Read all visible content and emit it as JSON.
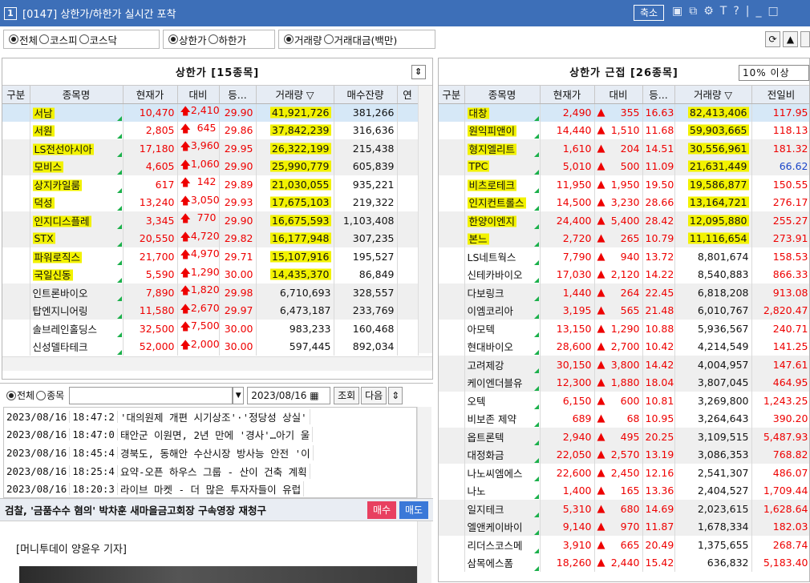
{
  "window": {
    "number": "1",
    "title": "[0147] 상한가/하한가 실시간 포착",
    "shrink_label": "축소"
  },
  "filters": {
    "market": [
      "전체",
      "코스피",
      "코스닥"
    ],
    "limit": [
      "상한가",
      "하한가"
    ],
    "volume": [
      "거래량",
      "거래대금(백만)"
    ]
  },
  "left_panel": {
    "title": "상한가 [15종목]",
    "columns": [
      "구분",
      "종목명",
      "현재가",
      "대비",
      "등...",
      "거래량 ▽",
      "매수잔량",
      "연"
    ],
    "rows": [
      {
        "name": "서남",
        "price": "10,470",
        "diff": "2,410",
        "rate": "29.90",
        "volume": "41,921,726",
        "bid": "381,266",
        "hl": true
      },
      {
        "name": "서원",
        "price": "2,805",
        "diff": "645",
        "rate": "29.86",
        "volume": "37,842,239",
        "bid": "316,636",
        "hl": true
      },
      {
        "name": "LS전선아시아",
        "price": "17,180",
        "diff": "3,960",
        "rate": "29.95",
        "volume": "26,322,199",
        "bid": "215,438",
        "hl": true
      },
      {
        "name": "모비스",
        "price": "4,605",
        "diff": "1,060",
        "rate": "29.90",
        "volume": "25,990,779",
        "bid": "605,839",
        "hl": true
      },
      {
        "name": "상지카일룸",
        "price": "617",
        "diff": "142",
        "rate": "29.89",
        "volume": "21,030,055",
        "bid": "935,221",
        "hl": true
      },
      {
        "name": "덕성",
        "price": "13,240",
        "diff": "3,050",
        "rate": "29.93",
        "volume": "17,675,103",
        "bid": "219,322",
        "hl": true
      },
      {
        "name": "인지디스플레",
        "price": "3,345",
        "diff": "770",
        "rate": "29.90",
        "volume": "16,675,593",
        "bid": "1,103,408",
        "hl": true
      },
      {
        "name": "STX",
        "price": "20,550",
        "diff": "4,720",
        "rate": "29.82",
        "volume": "16,177,948",
        "bid": "307,235",
        "hl": true
      },
      {
        "name": "파워로직스",
        "price": "21,700",
        "diff": "4,970",
        "rate": "29.71",
        "volume": "15,107,916",
        "bid": "195,527",
        "hl": true
      },
      {
        "name": "국일신동",
        "price": "5,590",
        "diff": "1,290",
        "rate": "30.00",
        "volume": "14,435,370",
        "bid": "86,849",
        "hl": true
      },
      {
        "name": "인트론바이오",
        "price": "7,890",
        "diff": "1,820",
        "rate": "29.98",
        "volume": "6,710,693",
        "bid": "328,557",
        "hl": false
      },
      {
        "name": "탑엔지니어링",
        "price": "11,580",
        "diff": "2,670",
        "rate": "29.97",
        "volume": "6,473,187",
        "bid": "233,769",
        "hl": false
      },
      {
        "name": "솔브레인홀딩스",
        "price": "32,500",
        "diff": "7,500",
        "rate": "30.00",
        "volume": "983,233",
        "bid": "160,468",
        "hl": false
      },
      {
        "name": "신성델타테크",
        "price": "52,000",
        "diff": "2,000",
        "rate": "30.00",
        "volume": "597,445",
        "bid": "892,034",
        "hl": false
      }
    ]
  },
  "right_panel": {
    "title": "상한가 근접 [26종목]",
    "threshold": "10% 이상",
    "columns": [
      "구분",
      "종목명",
      "현재가",
      "대비",
      "등...",
      "거래량 ▽",
      "전일비"
    ],
    "rows": [
      {
        "name": "대창",
        "price": "2,490",
        "diff": "355",
        "rate": "16.63",
        "volume": "82,413,406",
        "prev": "117.95",
        "hl": true
      },
      {
        "name": "원익피앤이",
        "price": "14,440",
        "diff": "1,510",
        "rate": "11.68",
        "volume": "59,903,665",
        "prev": "118.13",
        "hl": true
      },
      {
        "name": "형지엘리트",
        "price": "1,610",
        "diff": "204",
        "rate": "14.51",
        "volume": "30,556,961",
        "prev": "181.32",
        "hl": true
      },
      {
        "name": "TPC",
        "price": "5,010",
        "diff": "500",
        "rate": "11.09",
        "volume": "21,631,449",
        "prev": "66.62",
        "hl": true,
        "prevBlue": true
      },
      {
        "name": "비츠로테크",
        "price": "11,950",
        "diff": "1,950",
        "rate": "19.50",
        "volume": "19,586,877",
        "prev": "150.55",
        "hl": true
      },
      {
        "name": "인지컨트롤스",
        "price": "14,500",
        "diff": "3,230",
        "rate": "28.66",
        "volume": "13,164,721",
        "prev": "276.17",
        "hl": true
      },
      {
        "name": "한양이엔지",
        "price": "24,400",
        "diff": "5,400",
        "rate": "28.42",
        "volume": "12,095,880",
        "prev": "255.27",
        "hl": true
      },
      {
        "name": "본느",
        "price": "2,720",
        "diff": "265",
        "rate": "10.79",
        "volume": "11,116,654",
        "prev": "273.91",
        "hl": true
      },
      {
        "name": "LS네트웍스",
        "price": "7,790",
        "diff": "940",
        "rate": "13.72",
        "volume": "8,801,674",
        "prev": "158.53",
        "hl": false
      },
      {
        "name": "신테카바이오",
        "price": "17,030",
        "diff": "2,120",
        "rate": "14.22",
        "volume": "8,540,883",
        "prev": "866.33",
        "hl": false
      },
      {
        "name": "다보링크",
        "price": "1,440",
        "diff": "264",
        "rate": "22.45",
        "volume": "6,818,208",
        "prev": "913.08",
        "hl": false
      },
      {
        "name": "이엠코리아",
        "price": "3,195",
        "diff": "565",
        "rate": "21.48",
        "volume": "6,010,767",
        "prev": "2,820.47",
        "hl": false
      },
      {
        "name": "아모텍",
        "price": "13,150",
        "diff": "1,290",
        "rate": "10.88",
        "volume": "5,936,567",
        "prev": "240.71",
        "hl": false
      },
      {
        "name": "현대바이오",
        "price": "28,600",
        "diff": "2,700",
        "rate": "10.42",
        "volume": "4,214,549",
        "prev": "141.25",
        "hl": false
      },
      {
        "name": "고려제강",
        "price": "30,150",
        "diff": "3,800",
        "rate": "14.42",
        "volume": "4,004,957",
        "prev": "147.61",
        "hl": false
      },
      {
        "name": "케이엔더블유",
        "price": "12,300",
        "diff": "1,880",
        "rate": "18.04",
        "volume": "3,807,045",
        "prev": "464.95",
        "hl": false
      },
      {
        "name": "오텍",
        "price": "6,150",
        "diff": "600",
        "rate": "10.81",
        "volume": "3,269,800",
        "prev": "1,243.25",
        "hl": false
      },
      {
        "name": "비보존 제약",
        "price": "689",
        "diff": "68",
        "rate": "10.95",
        "volume": "3,264,643",
        "prev": "390.20",
        "hl": false
      },
      {
        "name": "옵트론텍",
        "price": "2,940",
        "diff": "495",
        "rate": "20.25",
        "volume": "3,109,515",
        "prev": "5,487.93",
        "hl": false
      },
      {
        "name": "대정화금",
        "price": "22,050",
        "diff": "2,570",
        "rate": "13.19",
        "volume": "3,086,353",
        "prev": "768.82",
        "hl": false
      },
      {
        "name": "나노씨엠에스",
        "price": "22,600",
        "diff": "2,450",
        "rate": "12.16",
        "volume": "2,541,307",
        "prev": "486.07",
        "hl": false
      },
      {
        "name": "나노",
        "price": "1,400",
        "diff": "165",
        "rate": "13.36",
        "volume": "2,404,527",
        "prev": "1,709.44",
        "hl": false
      },
      {
        "name": "일지테크",
        "price": "5,310",
        "diff": "680",
        "rate": "14.69",
        "volume": "2,023,615",
        "prev": "1,628.64",
        "hl": false
      },
      {
        "name": "엘앤케이바이",
        "price": "9,140",
        "diff": "970",
        "rate": "11.87",
        "volume": "1,678,334",
        "prev": "182.03",
        "hl": false
      },
      {
        "name": "리더스코스메",
        "price": "3,910",
        "diff": "665",
        "rate": "20.49",
        "volume": "1,375,655",
        "prev": "268.74",
        "hl": false
      },
      {
        "name": "삼목에스폼",
        "price": "18,260",
        "diff": "2,440",
        "rate": "15.42",
        "volume": "636,832",
        "prev": "5,183.40",
        "hl": false
      }
    ]
  },
  "news": {
    "radio": [
      "전체",
      "종목"
    ],
    "date": "2023/08/16",
    "query_label": "조회",
    "next_label": "다음",
    "items": [
      {
        "date": "2023/08/16",
        "time": "18:47:2",
        "title": "'대의원제 개편 시기상조'·'정당성 상실'"
      },
      {
        "date": "2023/08/16",
        "time": "18:47:0",
        "title": "태안군 이원면, 2년 만에 '경사'…아기 울"
      },
      {
        "date": "2023/08/16",
        "time": "18:45:4",
        "title": "경북도, 동해안 수산시장 방사능 안전 '이"
      },
      {
        "date": "2023/08/16",
        "time": "18:25:4",
        "title": "요약-오픈 하우스 그룹 - 산이 건축 계획"
      },
      {
        "date": "2023/08/16",
        "time": "18:20:3",
        "title": "라이브 마켓 - 더 많은 투자자들이 유럽"
      }
    ],
    "headline": "검찰, '금품수수 혐의' 박차훈 새마을금고회장 구속영장 재청구",
    "buy_label": "매수",
    "sell_label": "매도",
    "byline": "[머니투데이 양윤우 기자]"
  },
  "colors": {
    "titlebar": "#3d6fb8",
    "up": "#ee0000",
    "highlight": "#f2f200",
    "buy": "#e84060",
    "sell": "#3a78d8"
  }
}
